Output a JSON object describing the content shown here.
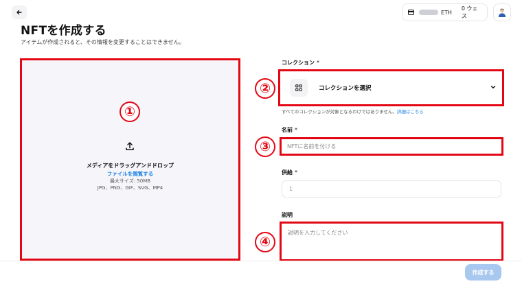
{
  "header": {
    "wallet_currency": "ETH",
    "wallet_weth": "0 ウェス"
  },
  "page": {
    "title": "NFTを作成する",
    "subtitle": "アイテムが作成されると、その情報を変更することはできません。"
  },
  "dropzone": {
    "main_text": "メディアをドラッグアンドドロップ",
    "browse_link": "ファイルを閲覧する",
    "max_size": "最大サイズ: 50MB",
    "file_types": "JPG、PNG、GIF、SVG、MP4"
  },
  "form": {
    "collection_label": "コレクション",
    "collection_select": "コレクションを選択",
    "collection_helper": "すべてのコレクションが対象となるわけではありません。",
    "collection_helper_link": "詳細はこちら",
    "name_label": "名前",
    "name_placeholder": "NFTに名前を付ける",
    "supply_label": "供給",
    "supply_value": "1",
    "description_label": "説明",
    "description_placeholder": "説明を入力してください",
    "required_mark": "*"
  },
  "footer": {
    "create_button": "作成する"
  },
  "annotations": {
    "n1": "①",
    "n2": "②",
    "n3": "③",
    "n4": "④"
  },
  "colors": {
    "annotation_red": "#e30613",
    "link_blue": "#2081e2",
    "button_disabled": "#a9c8f0"
  },
  "icons": [
    "back-arrow-icon",
    "wallet-card-icon",
    "avatar-icon",
    "upload-icon",
    "grid-icon",
    "chevron-down-icon"
  ]
}
